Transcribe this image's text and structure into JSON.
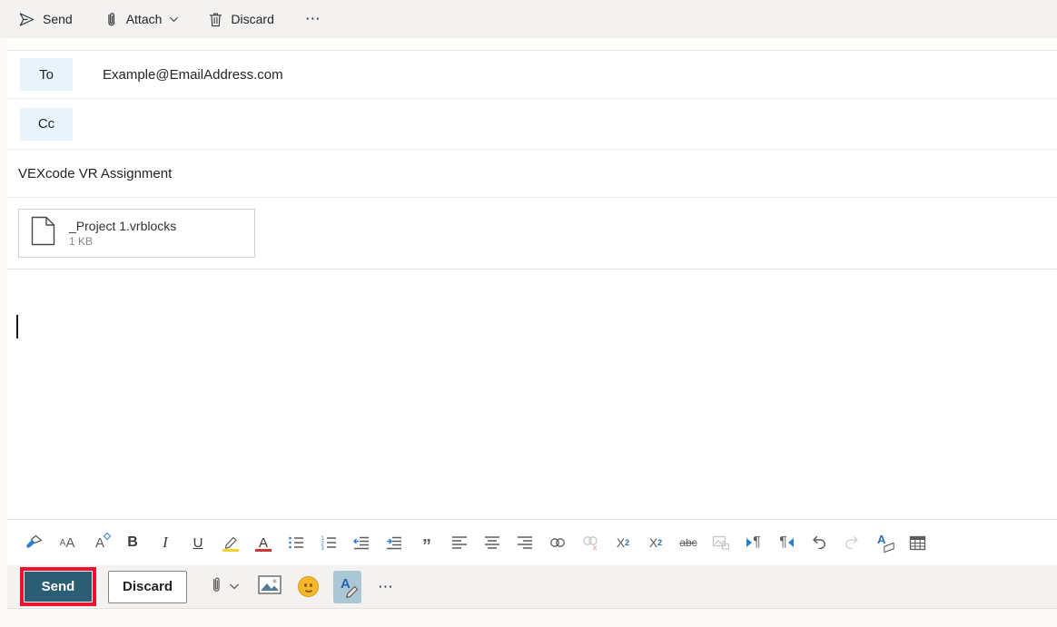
{
  "top_toolbar": {
    "send_label": "Send",
    "attach_label": "Attach",
    "discard_label": "Discard",
    "more_label": "⋯"
  },
  "recipients": {
    "to_label": "To",
    "to_value": "Example@EmailAddress.com",
    "cc_label": "Cc",
    "cc_value": ""
  },
  "subject": {
    "value": "VEXcode VR Assignment"
  },
  "attachment": {
    "filename": "_Project 1.vrblocks",
    "filesize": "1 KB"
  },
  "format_toolbar": {
    "tools": [
      "format-painter",
      "font",
      "font-size",
      "bold",
      "italic",
      "underline",
      "text-highlight",
      "font-color",
      "bulleted-list",
      "numbered-list",
      "decrease-indent",
      "increase-indent",
      "quote",
      "align-left",
      "align-center",
      "align-right",
      "insert-link",
      "remove-link",
      "superscript",
      "subscript",
      "strikethrough",
      "insert-picture-inline",
      "left-to-right",
      "right-to-left",
      "undo",
      "redo",
      "clear-formatting",
      "insert-table"
    ],
    "disabled_tools": [
      "remove-link",
      "insert-picture-inline",
      "redo"
    ],
    "glyphs": {
      "font_small": "A",
      "font_large": "A",
      "size_letter": "A",
      "bold": "B",
      "italic": "I",
      "underline": "U",
      "color_letter": "A",
      "quote": "”",
      "sup_base": "X",
      "sup_mark": "2",
      "sub_base": "X",
      "sub_mark": "2",
      "strike": "abc",
      "pilcrow_ltr": "¶",
      "pilcrow_rtl": "¶",
      "clear_letter": "A"
    }
  },
  "action_bar": {
    "send_label": "Send",
    "discard_label": "Discard",
    "more_label": "⋯",
    "pen_letter": "A",
    "selected_tool": "draw-ink"
  },
  "editor": {
    "body_text": "",
    "caret_visible": true
  },
  "colors": {
    "top_toolbar_bg": "#f3f2f1",
    "chip_bg": "#e9f3fa",
    "send_button_bg": "#2b5e74",
    "annotation_red": "#e8142d",
    "selected_tool_bg": "#abc7d3",
    "accent_blue": "#2b7cd3",
    "divider": "#e3e1df",
    "highlight_yellow": "#f8d22a",
    "font_color_red": "#d13438",
    "emoji_yellow": "#f7b82a"
  }
}
